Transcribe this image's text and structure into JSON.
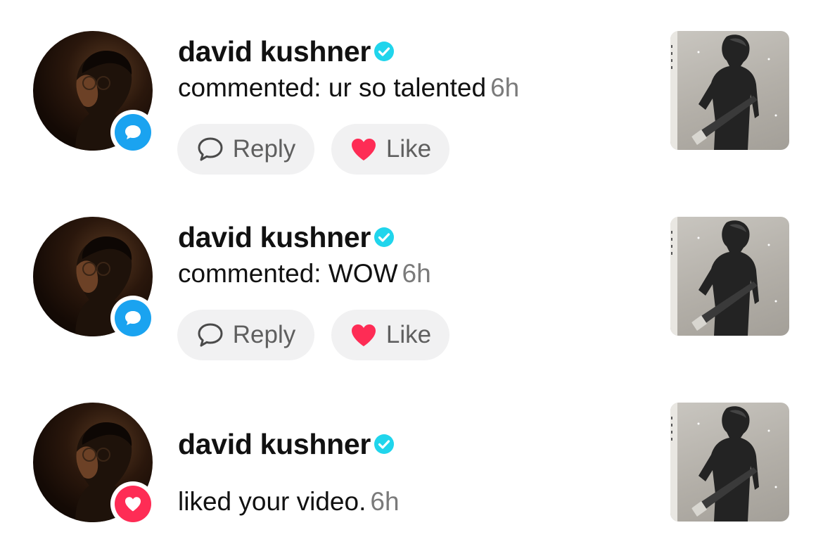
{
  "notifications": [
    {
      "username": "david kushner",
      "activity": "commented: ur so talented",
      "time": "6h",
      "type": "comment",
      "reply_label": "Reply",
      "like_label": "Like"
    },
    {
      "username": "david kushner",
      "activity": "commented: WOW",
      "time": "6h",
      "type": "comment",
      "reply_label": "Reply",
      "like_label": "Like"
    },
    {
      "username": "david kushner",
      "activity": "liked your video.",
      "time": "6h",
      "type": "like"
    }
  ],
  "icons": {
    "verified": "verified-badge-icon",
    "comment_badge": "comment-bubble-icon",
    "like_badge": "heart-icon",
    "reply": "speech-bubble-icon",
    "like": "heart-icon"
  },
  "colors": {
    "verified": "#20d5ec",
    "comment_badge": "#1aa3f0",
    "like_badge": "#fe2c55",
    "like_heart": "#fe2c55",
    "time": "#7a7a7a",
    "button_bg": "#f1f1f2"
  }
}
